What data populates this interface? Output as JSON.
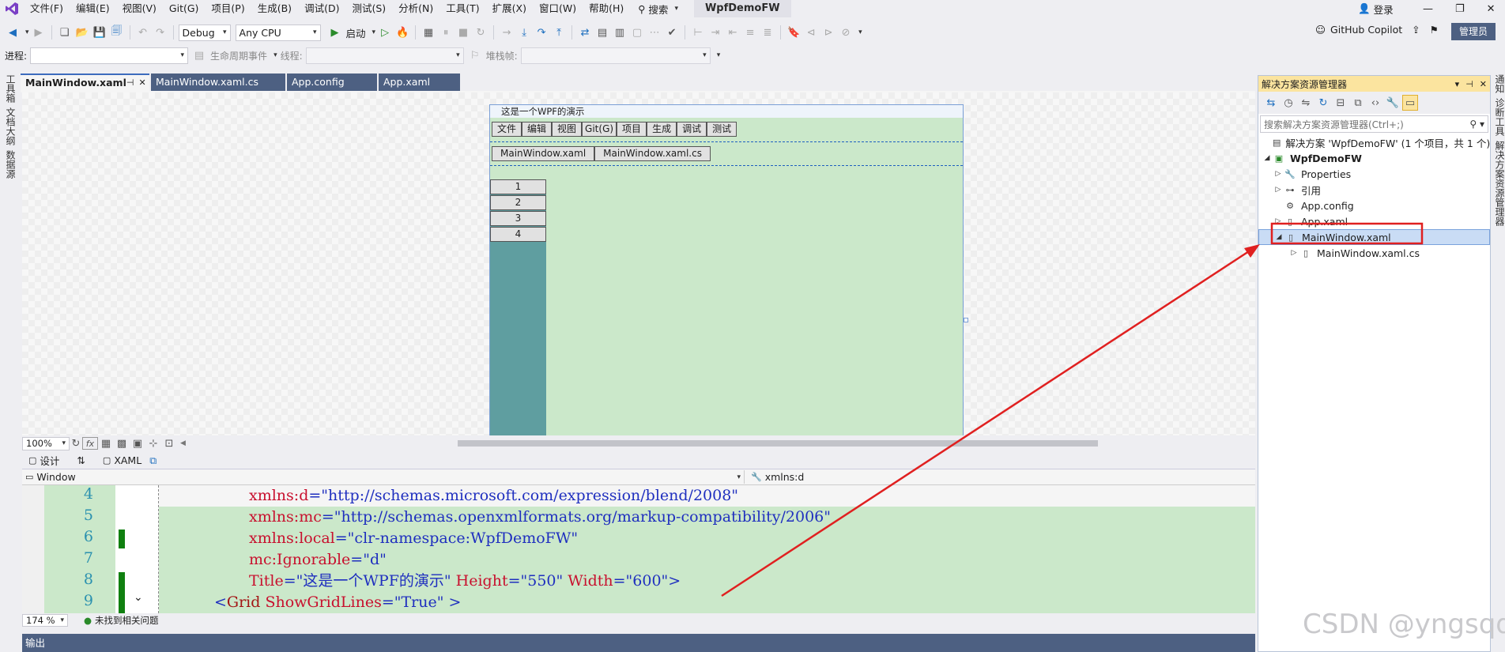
{
  "menubar": {
    "items": [
      "文件(F)",
      "编辑(E)",
      "视图(V)",
      "Git(G)",
      "项目(P)",
      "生成(B)",
      "调试(D)",
      "测试(S)",
      "分析(N)",
      "工具(T)",
      "扩展(X)",
      "窗口(W)",
      "帮助(H)"
    ],
    "search_label": "搜索",
    "project_name": "WpfDemoFW",
    "login_label": "登录",
    "copilot_label": "GitHub Copilot",
    "admin_label": "管理员"
  },
  "toolbar": {
    "config": "Debug",
    "platform": "Any CPU",
    "start_label": "启动"
  },
  "toolbar2": {
    "process_label": "进程:",
    "lifecycle_label": "生命周期事件",
    "thread_label": "线程:",
    "stackframe_label": "堆栈帧:"
  },
  "left_strip": [
    "工具箱",
    "文档大纲",
    "数据源"
  ],
  "tabs": [
    {
      "label": "MainWindow.xaml",
      "active": true
    },
    {
      "label": "MainWindow.xaml.cs",
      "active": false
    },
    {
      "label": "App.config",
      "active": false
    },
    {
      "label": "App.xaml",
      "active": false
    }
  ],
  "wpf_window": {
    "title": "这是一个WPF的演示",
    "menu_buttons": [
      "文件",
      "编辑",
      "视图",
      "Git(G)",
      "项目",
      "生成",
      "调试",
      "测试"
    ],
    "tab_buttons": [
      "MainWindow.xaml",
      "MainWindow.xaml.cs"
    ],
    "side_buttons": [
      "1",
      "2",
      "3",
      "4"
    ]
  },
  "designbar": {
    "zoom": "100%"
  },
  "splitbar": {
    "design_label": "设计",
    "xaml_label": "XAML"
  },
  "navbar": {
    "left": "Window",
    "right": "xmlns:d"
  },
  "code": [
    {
      "num": "4",
      "text": "xmlns:d=\"http://schemas.microsoft.com/expression/blend/2008\""
    },
    {
      "num": "5",
      "text": "xmlns:mc=\"http://schemas.openxmlformats.org/markup-compatibility/2006\""
    },
    {
      "num": "6",
      "text": "xmlns:local=\"clr-namespace:WpfDemoFW\""
    },
    {
      "num": "7",
      "text": "mc:Ignorable=\"d\""
    },
    {
      "num": "8",
      "text": "Title=\"这是一个WPF的演示\" Height=\"550\" Width=\"600\">"
    },
    {
      "num": "9",
      "text": "<Grid ShowGridLines=\"True\" >"
    }
  ],
  "statusbar": {
    "zoom": "174 %",
    "issues": "未找到相关问题"
  },
  "output_label": "输出",
  "solution_explorer": {
    "title": "解决方案资源管理器",
    "search_placeholder": "搜索解决方案资源管理器(Ctrl+;)",
    "items": [
      {
        "label": "解决方案 'WpfDemoFW' (1 个项目，共 1 个)",
        "level": 0,
        "expander": "",
        "icon": "solution-icon"
      },
      {
        "label": "WpfDemoFW",
        "level": 1,
        "expander": "expanded",
        "icon": "csharp-project-icon",
        "bold": true
      },
      {
        "label": "Properties",
        "level": 2,
        "expander": "collapsed",
        "icon": "wrench-icon"
      },
      {
        "label": "引用",
        "level": 2,
        "expander": "collapsed",
        "icon": "references-icon"
      },
      {
        "label": "App.config",
        "level": 2,
        "expander": "",
        "icon": "config-file-icon"
      },
      {
        "label": "App.xaml",
        "level": 2,
        "expander": "collapsed",
        "icon": "xaml-file-icon"
      },
      {
        "label": "MainWindow.xaml",
        "level": 2,
        "expander": "expanded",
        "icon": "xaml-file-icon",
        "selected": true
      },
      {
        "label": "MainWindow.xaml.cs",
        "level": 3,
        "expander": "collapsed",
        "icon": "cs-file-icon"
      }
    ]
  },
  "right_strip": [
    "通知",
    "诊断工具",
    "解决方案资源管理器"
  ],
  "watermark": "CSDN @yngsqq",
  "colors": {
    "accent": "#3c6bbd",
    "annotation": "#e02020",
    "grid_bg": "#cbe8ca",
    "side_bg": "#5f9ea0"
  }
}
